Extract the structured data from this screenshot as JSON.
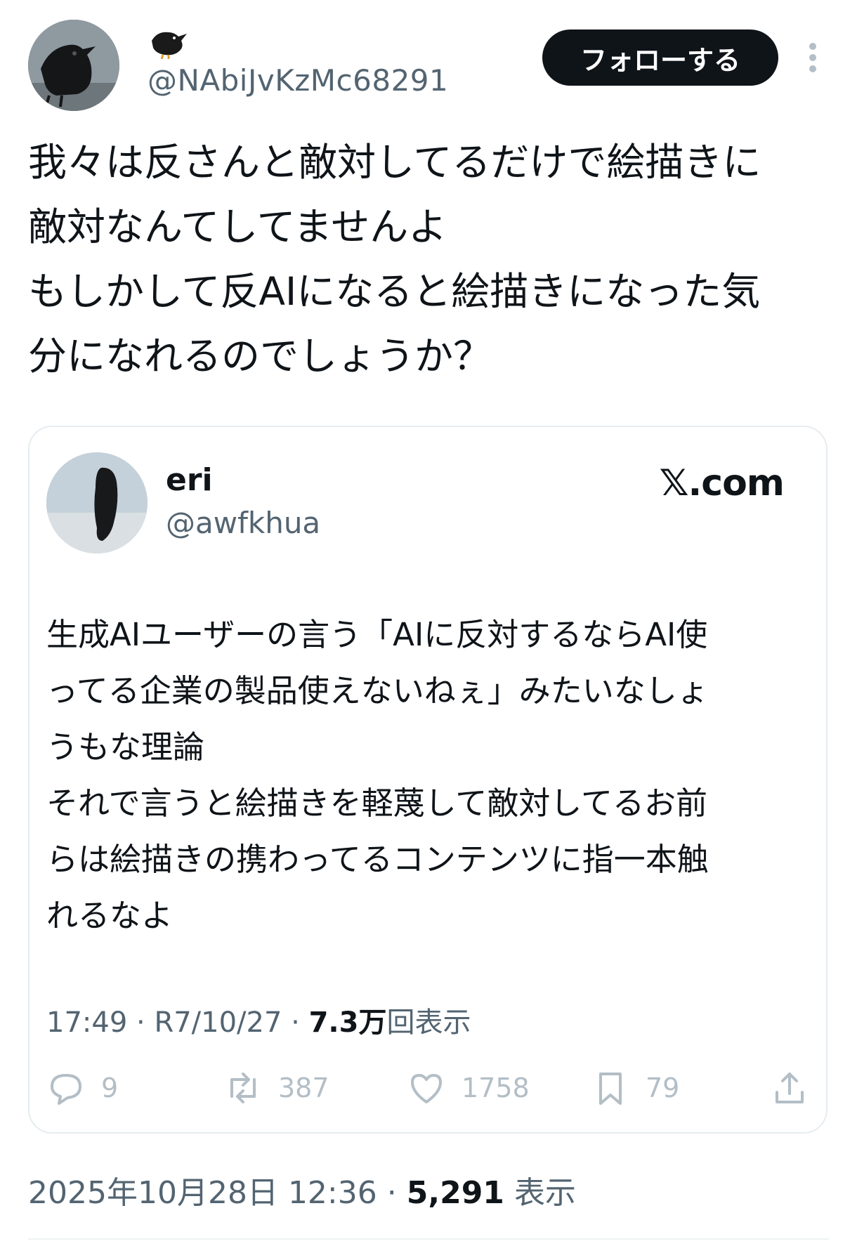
{
  "author": {
    "display_name_emoji": "🐦‍⬛",
    "handle": "@NAbiJvKzMc68291",
    "avatar_icon": "crow-avatar"
  },
  "follow_button": {
    "label": "フォローする"
  },
  "more_icon": "more-vertical-icon",
  "tweet": {
    "text": "我々は反さんと敵対してるだけで絵描きに\n敵対なんてしてませんよ\nもしかして反AIになると絵描きになった気\n分になれるのでしょうか？",
    "time": "2025年10月28日 12:36",
    "separator": "·",
    "views_count": "5,291",
    "views_label": "表示"
  },
  "quote": {
    "display_name": "eri",
    "handle": "@awfkhua",
    "source": "𝕏.com",
    "text": "生成AIユーザーの言う「AIに反対するならAI使\nってる企業の製品使えないねぇ」みたいなしょ\nうもな理論\nそれで言うと絵描きを軽蔑して敵対してるお前\nらは絵描きの携わってるコンテンツに指一本触\nれるなよ",
    "time": "17:49",
    "date": "R7/10/27",
    "separator": "·",
    "views_count": "7.3万",
    "views_label": "回表示",
    "actions": {
      "reply_count": "9",
      "retweet_count": "387",
      "like_count": "1758",
      "bookmark_count": "79"
    }
  },
  "colors": {
    "text_primary": "#0f1419",
    "text_secondary": "#536471",
    "action_muted": "#b3bec6",
    "border": "#e6ecf0",
    "button_bg": "#0f1419"
  }
}
